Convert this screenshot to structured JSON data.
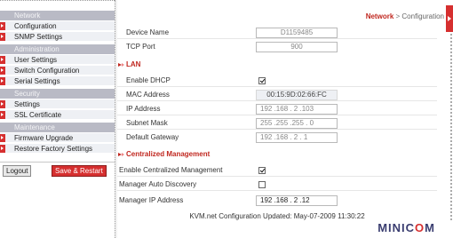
{
  "sidebar": {
    "sections": [
      {
        "label": "Network",
        "items": [
          "Configuration",
          "SNMP Settings"
        ]
      },
      {
        "label": "Administration",
        "items": [
          "User Settings",
          "Switch Configuration",
          "Serial Settings"
        ]
      },
      {
        "label": "Security",
        "items": [
          "Settings",
          "SSL Certificate"
        ]
      },
      {
        "label": "Maintenance",
        "items": [
          "Firmware Upgrade",
          "Restore Factory Settings"
        ]
      }
    ],
    "logout_label": "Logout",
    "save_restart_label": "Save & Restart"
  },
  "breadcrumb": {
    "section": "Network",
    "separator": ">",
    "current": "Configuration"
  },
  "device": {
    "name_label": "Device Name",
    "name_value": "D1159485",
    "port_label": "TCP Port",
    "port_value": "900"
  },
  "lan": {
    "header": "LAN",
    "dhcp_label": "Enable DHCP",
    "dhcp_checked": true,
    "mac_label": "MAC Address",
    "mac_value": "00:15:9D:02:66:FC",
    "ip_label": "IP Address",
    "ip_value": "192 .168 . 2 .103",
    "mask_label": "Subnet Mask",
    "mask_value": "255 .255 .255 . 0",
    "gateway_label": "Default Gateway",
    "gateway_value": "192 .168 . 2 . 1"
  },
  "central": {
    "header": "Centralized Management",
    "enable_label": "Enable Centralized Management",
    "enable_checked": true,
    "discovery_label": "Manager Auto Discovery",
    "discovery_checked": false,
    "manager_ip_label": "Manager IP Address",
    "manager_ip_value": "192 .168 . 2 .12"
  },
  "status_text": "KVM.net Configuration Updated: May-07-2009 11:30:22",
  "logo": {
    "prefix": "MINIC",
    "o": "O",
    "suffix": "M"
  },
  "colors": {
    "accent": "#d62f2f",
    "section_bg": "#b9bac5",
    "item_bg": "#eef0f4"
  }
}
